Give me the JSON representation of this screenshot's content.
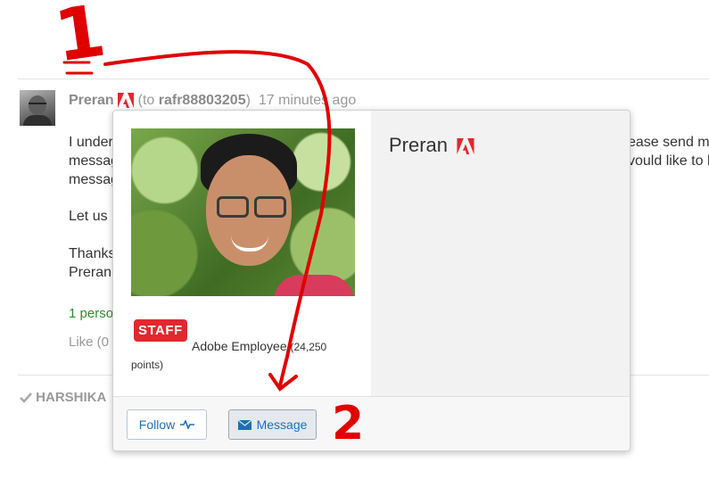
{
  "comment": {
    "author": "Preran",
    "to_prefix": "(to ",
    "to_user": "rafr88803205",
    "to_suffix": ")",
    "time": "17 minutes ago",
    "body_lines": [
      "I under",
      "messag",
      "messag",
      "Let us l",
      "Thanks",
      "Preran"
    ],
    "body_right_1": "ease send me",
    "body_right_2": "vould like to b",
    "likes_text": "1 persor",
    "like_text": "Like (0"
  },
  "next_comment": {
    "author": "HARSHIKA"
  },
  "popup": {
    "name": "Preran",
    "badge": "STAFF",
    "role": "Adobe Employee",
    "points_value": "24,250",
    "points_label": "points)",
    "follow_label": "Follow",
    "message_label": "Message"
  },
  "annotations": {
    "label_1": "1",
    "label_2": "2",
    "color": "#e00000"
  },
  "colors": {
    "adobe_red": "#e0282e",
    "link_blue": "#1f6fb2"
  }
}
